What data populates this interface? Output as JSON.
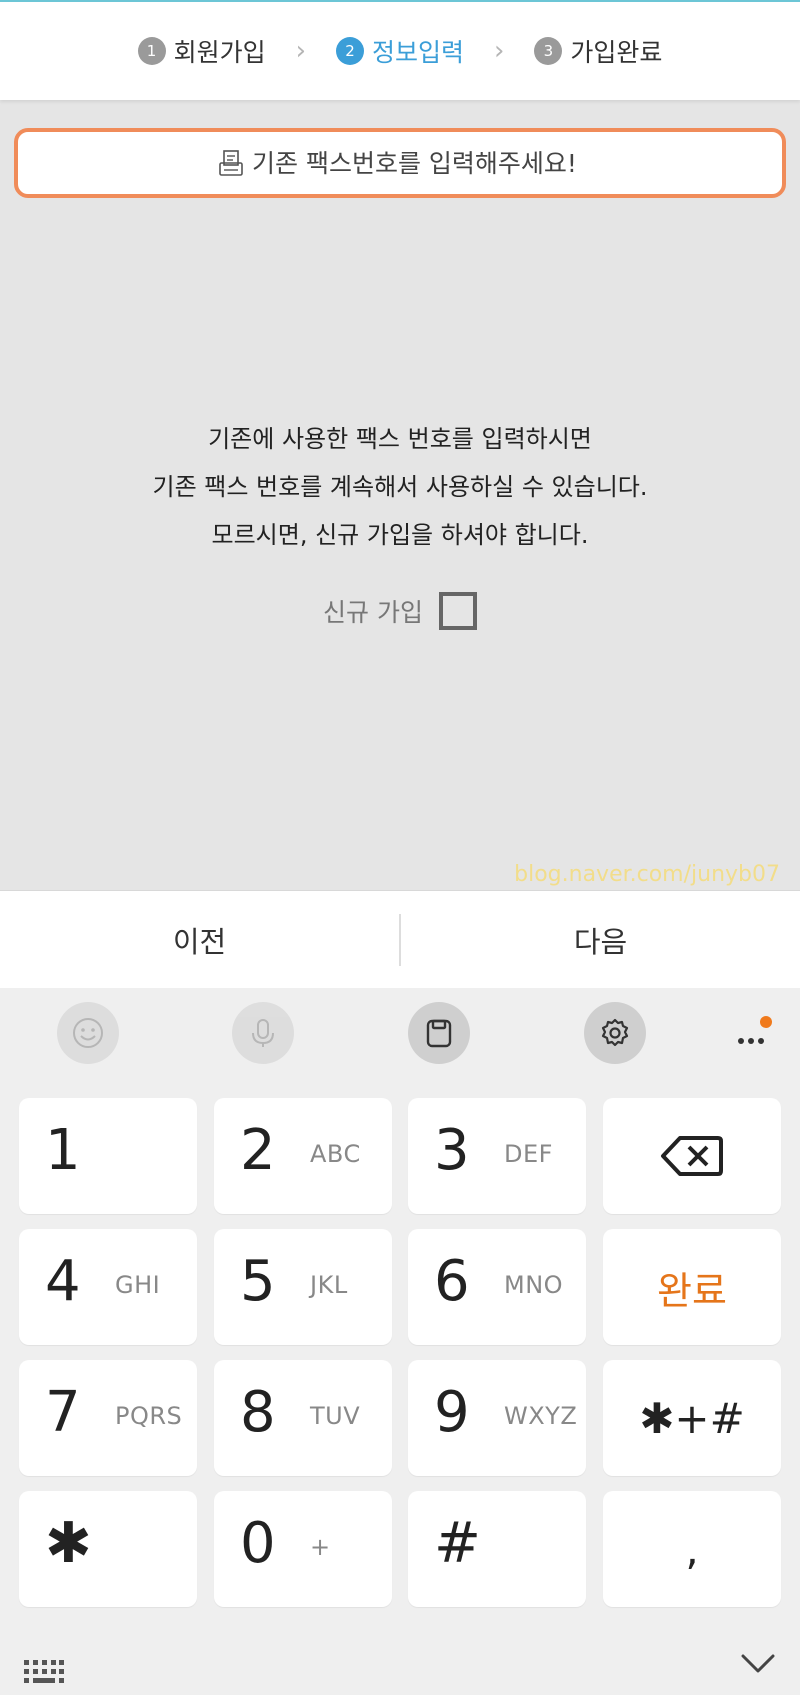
{
  "stepper": {
    "steps": [
      {
        "num": "1",
        "label": "회원가입"
      },
      {
        "num": "2",
        "label": "정보입력"
      },
      {
        "num": "3",
        "label": "가입완료"
      }
    ],
    "active_index": 1
  },
  "fax_input": {
    "placeholder": "기존 팩스번호를 입력해주세요!",
    "value": ""
  },
  "message": {
    "lines": [
      "기존에 사용한 팩스 번호를 입력하시면",
      "기존 팩스 번호를 계속해서 사용하실 수 있습니다.",
      "모르시면, 신규 가입을 하셔야 합니다."
    ]
  },
  "new_signup": {
    "label": "신규 가입",
    "checked": false
  },
  "watermark": "blog.naver.com/junyb07",
  "navbar": {
    "prev_label": "이전",
    "next_label": "다음"
  },
  "keyboard": {
    "toolbar_icons": [
      "emoji-icon",
      "microphone-icon",
      "clipboard-icon",
      "settings-icon",
      "more-icon"
    ],
    "accent_color": "#e5751a",
    "keys": [
      {
        "digit": "1",
        "letters": ""
      },
      {
        "digit": "2",
        "letters": "ABC"
      },
      {
        "digit": "3",
        "letters": "DEF"
      },
      {
        "digit": "4",
        "letters": "GHI"
      },
      {
        "digit": "5",
        "letters": "JKL"
      },
      {
        "digit": "6",
        "letters": "MNO"
      },
      {
        "digit": "7",
        "letters": "PQRS"
      },
      {
        "digit": "8",
        "letters": "TUV"
      },
      {
        "digit": "9",
        "letters": "WXYZ"
      },
      {
        "digit": "0",
        "letters": "+"
      }
    ],
    "done_label": "완료",
    "symbols_label": "✱+#",
    "star_label": "✱",
    "hash_label": "#",
    "comma_label": ","
  }
}
